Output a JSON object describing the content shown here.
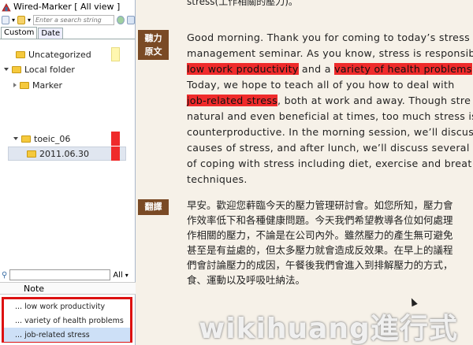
{
  "sidebar": {
    "title": "Wired-Marker [ All view ]",
    "search_placeholder": "Enter a search string",
    "tabs": [
      "Custom",
      "Date"
    ],
    "tree": [
      {
        "label": "Uncategorized",
        "swatch": "#fff7b0"
      },
      {
        "label": "Local folder"
      },
      {
        "label": "Marker"
      },
      {
        "label": "toeic_06",
        "swatch": "#ef2b2b"
      },
      {
        "label": "2011.06.30",
        "swatch": "#ef2b2b"
      }
    ],
    "filter_label": "All",
    "column_header": "Note",
    "notes": [
      "... low work productivity",
      "... variety of health problems",
      "... job-related stress"
    ]
  },
  "content": {
    "top_cut": "stress(工作相關的壓力)。",
    "label1": "聽力原文",
    "label2": "翻譯",
    "en": {
      "l1": "Good morning. Thank you for coming to today’s stress",
      "l2": "management seminar. As you know, stress is responsib",
      "l3_hl1": "low work productivity",
      "l3_mid": " and a ",
      "l3_hl2": "variety of health problems",
      "l4": "Today, we hope to teach all of you how to deal with",
      "l5_hl": "job-related stress",
      "l5_rest": ", both at work and away. Though stre",
      "l6": "natural and even beneficial at times, too much stress is",
      "l7": "counterproductive. In the morning session, we’ll discus",
      "l8": "causes of stress, and after lunch, we’ll discuss several",
      "l9": "of coping with stress including diet, exercise and breat",
      "l10": "techniques."
    },
    "zh": [
      "早安。歡迎您蓒臨今天的壓力管理研討會。如您所知，壓力會",
      "作效率低下和各種健康問題。今天我們希望教導各位如何處理",
      "作相關的壓力，不論是在公司內外。雖然壓力的產生無可避免",
      "甚至是有益處的，但太多壓力就會造成反效果。在早上的議程",
      "們會討論壓力的成因，午餐後我們會進入到排解壓力的方式，",
      "食、運動以及呼吸吐納法。"
    ],
    "watermark": "wikihuang進行式"
  },
  "colors": {
    "highlight": "#ef2b2b",
    "label_bg": "#7a4a25",
    "note_border": "#dd1111"
  }
}
